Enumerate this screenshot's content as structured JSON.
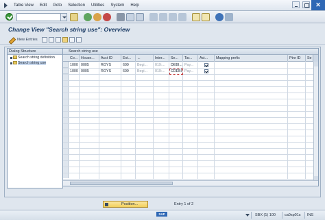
{
  "menu": {
    "items": [
      "Table View",
      "Edit",
      "Goto",
      "Selection",
      "Utilities",
      "System",
      "Help"
    ]
  },
  "toolbar": {
    "command_value": "",
    "icons": [
      "ok-icon",
      "save-icon",
      "back-icon",
      "exit-icon",
      "cancel-icon",
      "print-icon",
      "find-icon",
      "find-next-icon",
      "first-page-icon",
      "prev-page-icon",
      "next-page-icon",
      "last-page-icon",
      "new-session-icon",
      "shortcut-icon",
      "help-icon",
      "layout-icon"
    ]
  },
  "title": "Change View \"Search string use\": Overview",
  "app_toolbar": {
    "new_entries_label": "New Entries"
  },
  "dialog_structure": {
    "header": "Dialog Structure",
    "items": [
      {
        "label": "Search string definition",
        "selected": false
      },
      {
        "label": "Search string use",
        "selected": true
      }
    ]
  },
  "table": {
    "caption": "Search string use",
    "columns": [
      "Co...",
      "House...",
      "Acct ID",
      "Ext...",
      "←",
      "Inter...",
      "Se...",
      "Tar...",
      "Act...",
      "Mapping prefix",
      "Ptnr ID",
      "Se"
    ],
    "rows": [
      {
        "co": "1000",
        "house": "0005",
        "acct": "ROYS",
        "ext": "699",
        "arrow": "Begi...",
        "inter": "019:...",
        "se": "DEBI...",
        "tar": "Pay...",
        "act": true,
        "mapping": "",
        "ptnr": "",
        "se2": ""
      },
      {
        "co": "1000",
        "house": "0005",
        "acct": "ROYS",
        "ext": "699",
        "arrow": "Begi...",
        "inter": "019:...",
        "se": "CDEBI",
        "tar": "Pay...",
        "act": true,
        "mapping": "",
        "ptnr": "",
        "se2": ""
      }
    ]
  },
  "footer": {
    "position_label": "Position...",
    "entry_count": "Entry 1 of 2"
  },
  "status": {
    "sap_logo": "SAP",
    "system": "SBX (1) 100",
    "host": "ca0sp01s",
    "mode": "INS"
  }
}
